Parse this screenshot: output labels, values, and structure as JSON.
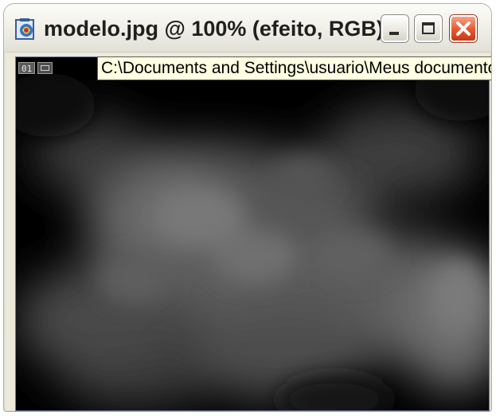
{
  "window": {
    "title": "modelo.jpg @ 100% (efeito, RGB)",
    "app_icon": "photoshop-document-icon",
    "buttons": {
      "minimize": "minimize-icon",
      "maximize": "maximize-icon",
      "close": "close-icon"
    },
    "close_color": "#e5582f"
  },
  "canvas": {
    "layer_number": "01",
    "layer_icon": "layer-thumbnail-icon",
    "background_color": "#000000"
  },
  "tooltip": {
    "text": "C:\\Documents and Settings\\usuario\\Meus documento"
  }
}
